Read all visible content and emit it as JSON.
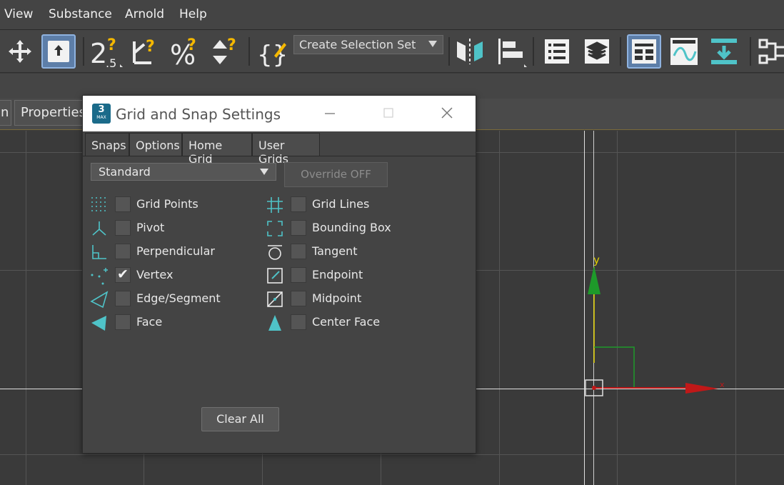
{
  "menu": {
    "view": "View",
    "substance": "Substance",
    "arnold": "Arnold",
    "help": "Help"
  },
  "toolbar": {
    "selection_set": "Create Selection Set",
    "snap_dim_label": "2.5"
  },
  "command_panel": {
    "tab_partial": "n",
    "properties": "Properties"
  },
  "dialog": {
    "title": "Grid and Snap Settings",
    "logo_text": "3",
    "logo_sub": "MAX",
    "tabs": [
      "Snaps",
      "Options",
      "Home Grid",
      "User Grids"
    ],
    "active_tab": "Snaps",
    "category": "Standard",
    "override": "Override OFF",
    "snaps_left": [
      {
        "label": "Grid Points",
        "icon": "grid-points-icon",
        "checked": false
      },
      {
        "label": "Pivot",
        "icon": "pivot-icon",
        "checked": false
      },
      {
        "label": "Perpendicular",
        "icon": "perpendicular-icon",
        "checked": false
      },
      {
        "label": "Vertex",
        "icon": "vertex-icon",
        "checked": true
      },
      {
        "label": "Edge/Segment",
        "icon": "edge-segment-icon",
        "checked": false
      },
      {
        "label": "Face",
        "icon": "face-icon",
        "checked": false
      }
    ],
    "snaps_right": [
      {
        "label": "Grid Lines",
        "icon": "grid-lines-icon",
        "checked": false
      },
      {
        "label": "Bounding Box",
        "icon": "bounding-box-icon",
        "checked": false
      },
      {
        "label": "Tangent",
        "icon": "tangent-icon",
        "checked": false
      },
      {
        "label": "Endpoint",
        "icon": "endpoint-icon",
        "checked": false
      },
      {
        "label": "Midpoint",
        "icon": "midpoint-icon",
        "checked": false
      },
      {
        "label": "Center Face",
        "icon": "center-face-icon",
        "checked": false
      }
    ],
    "clear_all": "Clear All"
  },
  "viewport": {
    "y_axis_label": "y",
    "x_axis_label": "x"
  },
  "colors": {
    "accent": "#4fc3c8",
    "active_button": "#5d7ea8",
    "y_axis": "#1e9a2a",
    "x_axis": "#c01818"
  }
}
